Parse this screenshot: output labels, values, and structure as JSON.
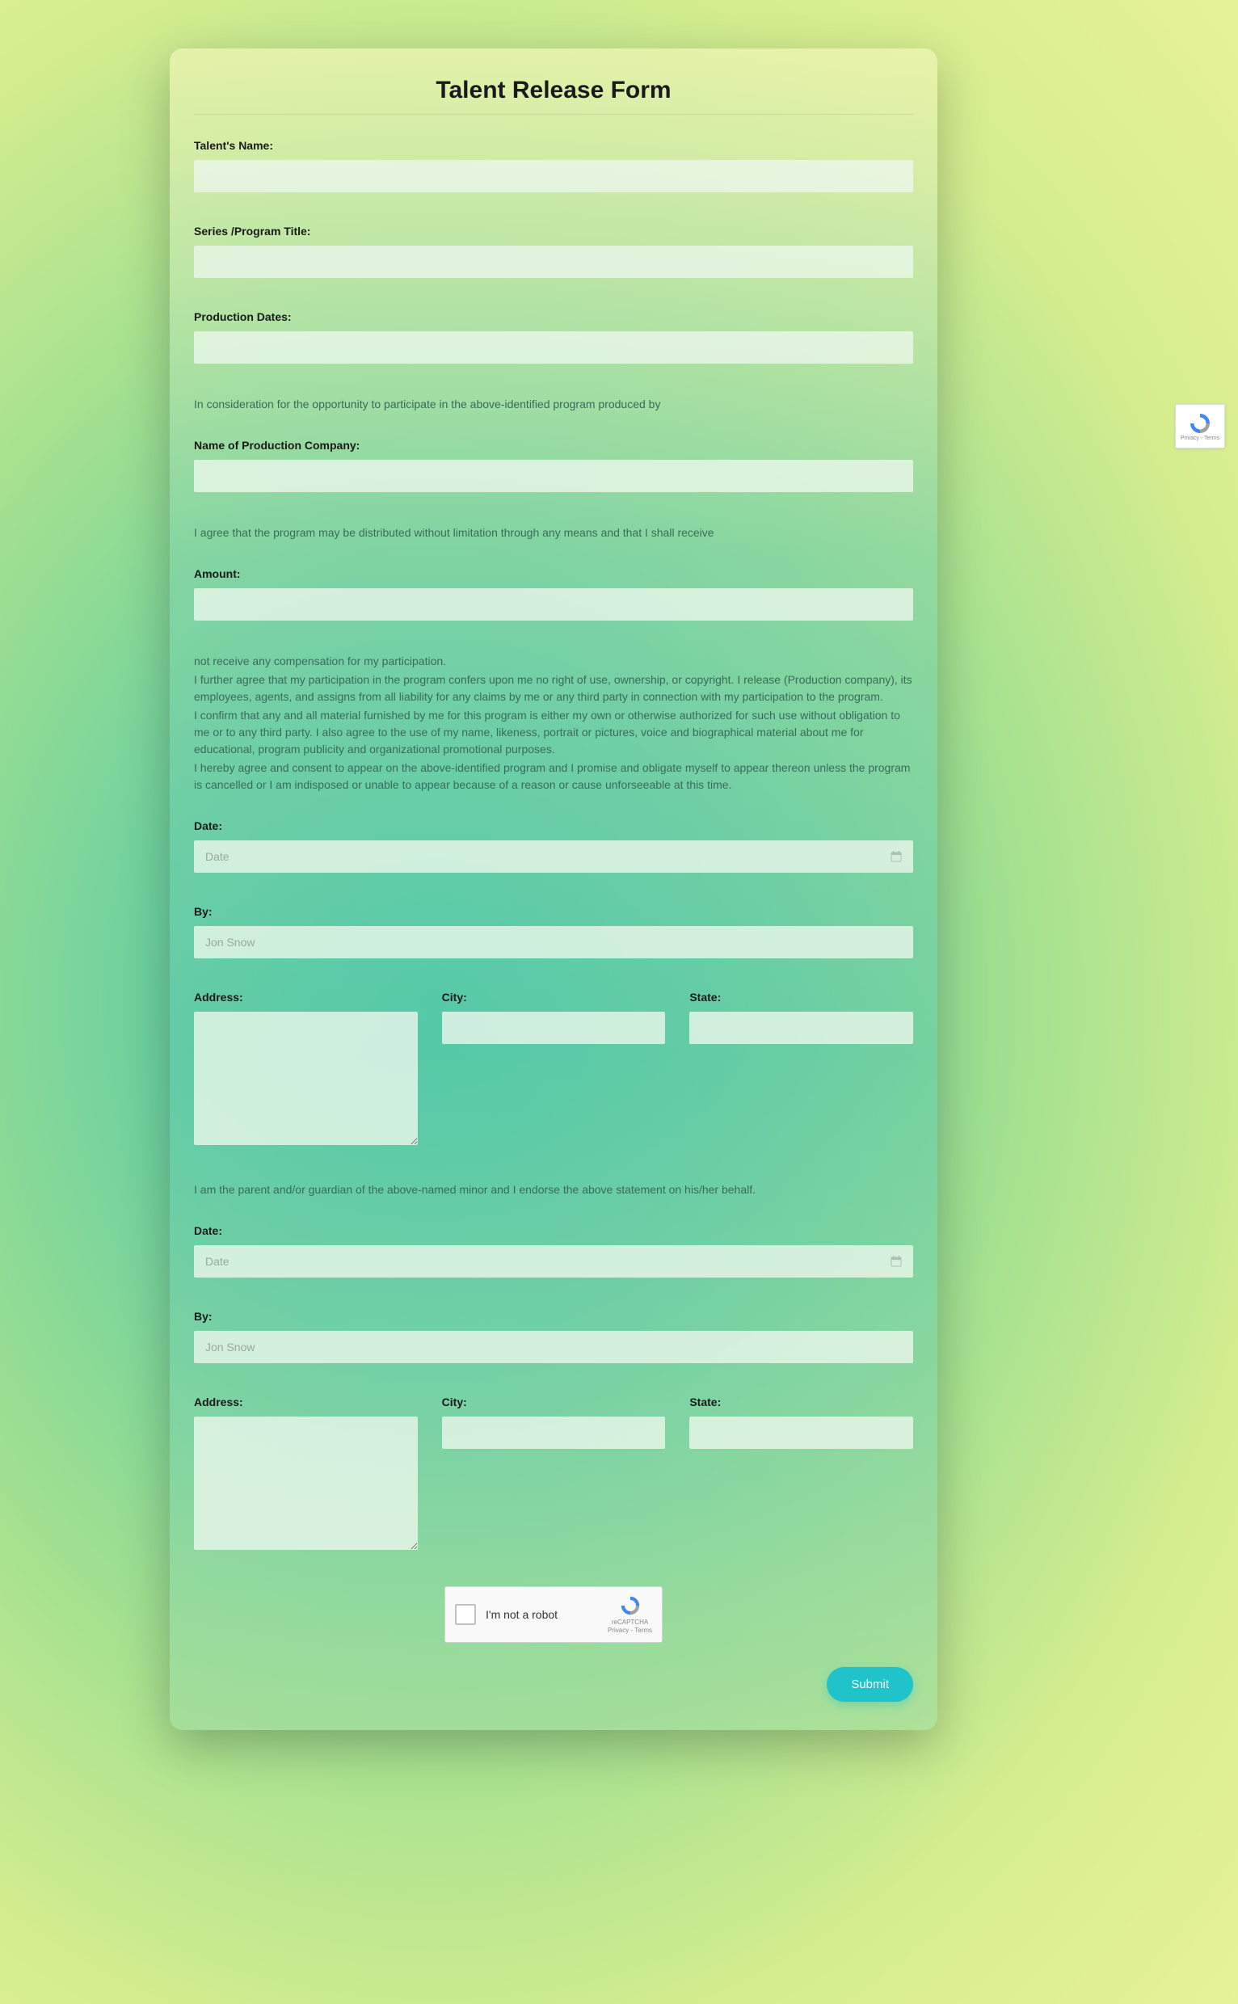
{
  "title": "Talent Release Form",
  "fields": {
    "talent_name": {
      "label": "Talent's Name:"
    },
    "series_title": {
      "label": "Series /Program Title:"
    },
    "production_dates": {
      "label": "Production Dates:"
    },
    "company": {
      "label": "Name of Production Company:"
    },
    "amount": {
      "label": "Amount:"
    },
    "date1": {
      "label": "Date:",
      "placeholder": "Date"
    },
    "by1": {
      "label": "By:",
      "placeholder": "Jon Snow"
    },
    "address1": {
      "label": "Address:"
    },
    "city1": {
      "label": "City:"
    },
    "state1": {
      "label": "State:"
    },
    "date2": {
      "label": "Date:",
      "placeholder": "Date"
    },
    "by2": {
      "label": "By:",
      "placeholder": "Jon Snow"
    },
    "address2": {
      "label": "Address:"
    },
    "city2": {
      "label": "City:"
    },
    "state2": {
      "label": "State:"
    }
  },
  "text": {
    "consideration": "In consideration for the opportunity to participate in the above-identified program produced by",
    "distribution": "I agree that the program may be distributed without limitation through any means and that I shall receive",
    "long": {
      "p1": "not receive any compensation for my participation.",
      "p2": "I further agree that my participation in the program confers upon me no right of use, ownership, or copyright. I release (Production company), its employees, agents, and assigns from all liability for any claims by me or any third party in connection with my participation to the program.",
      "p3": "I confirm that any and all material furnished by me for this program is either my own or otherwise authorized for such use without obligation to me or to any third party. I also agree to the use of my name, likeness, portrait or pictures, voice and biographical material about me for educational, program publicity and organizational promotional purposes.",
      "p4": "I hereby agree and consent to appear on the above-identified program and I promise and obligate myself to appear thereon unless the program is cancelled or I am indisposed or unable to appear because of a reason or cause unforseeable at this time."
    },
    "guardian": "I am the parent and/or guardian of the above-named minor and I endorse the above statement on his/her behalf."
  },
  "captcha": {
    "label": "I'm not a robot",
    "brand": "reCAPTCHA",
    "terms": "Privacy - Terms"
  },
  "submit": "Submit"
}
